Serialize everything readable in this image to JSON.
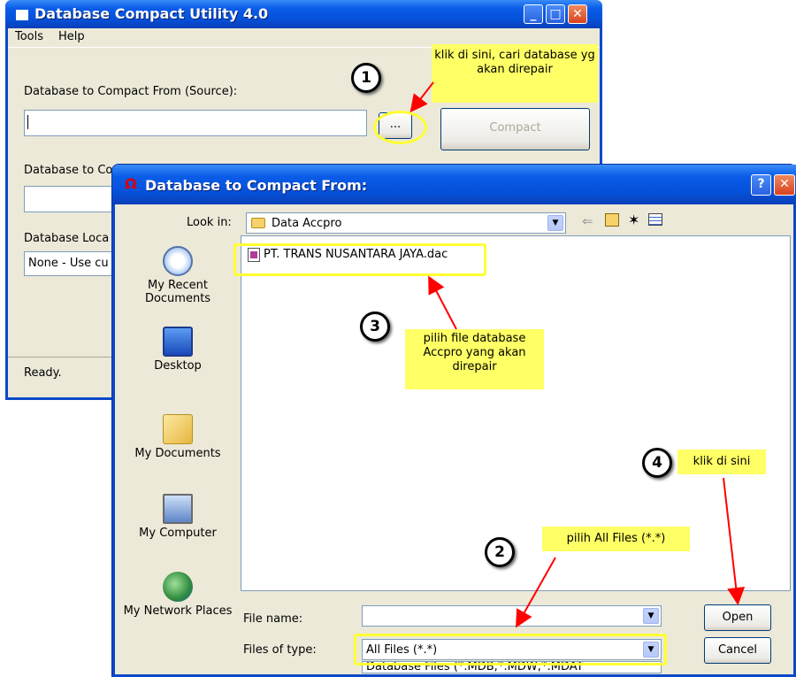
{
  "main_window": {
    "title": "Database Compact Utility 4.0",
    "menu": [
      "Tools",
      "Help"
    ],
    "source_label": "Database to Compact From (Source):",
    "source_value": "",
    "browse_label": "...",
    "compact_label": "Compact",
    "dest_label": "Database to Co",
    "locale_label": "Database Loca",
    "locale_value": "None - Use cu",
    "status": "Ready.",
    "controls": {
      "minimize": "_",
      "maximize": "□",
      "close": "✕"
    }
  },
  "dialog": {
    "title": "Database to Compact From:",
    "help_btn": "?",
    "close_btn": "✕",
    "look_in_label": "Look in:",
    "look_in_value": "Data Accpro",
    "places": [
      "My Recent Documents",
      "Desktop",
      "My Documents",
      "My Computer",
      "My Network Places"
    ],
    "files": [
      {
        "name": "PT. TRANS NUSANTARA JAYA.dac"
      }
    ],
    "file_name_label": "File name:",
    "file_name_value": "",
    "files_of_type_label": "Files of type:",
    "files_of_type_value": "All Files (*.*)",
    "files_of_type_option_partial": "Database Files (*.MDB;*.MDW;*.MDAT",
    "open_label": "Open",
    "cancel_label": "Cancel"
  },
  "annotations": [
    {
      "number": "1",
      "text": "klik di sini, cari database yg akan direpair"
    },
    {
      "number": "2",
      "text": "pilih All Files (*.*)"
    },
    {
      "number": "3",
      "text": "pilih file database Accpro yang akan direpair"
    },
    {
      "number": "4",
      "text": "klik di sini"
    }
  ],
  "colors": {
    "titlebar": "#0a5ce8",
    "window_bg": "#ece9d8",
    "note_bg": "#ffff66",
    "highlight": "#ffff33",
    "arrow": "#ff0000"
  }
}
